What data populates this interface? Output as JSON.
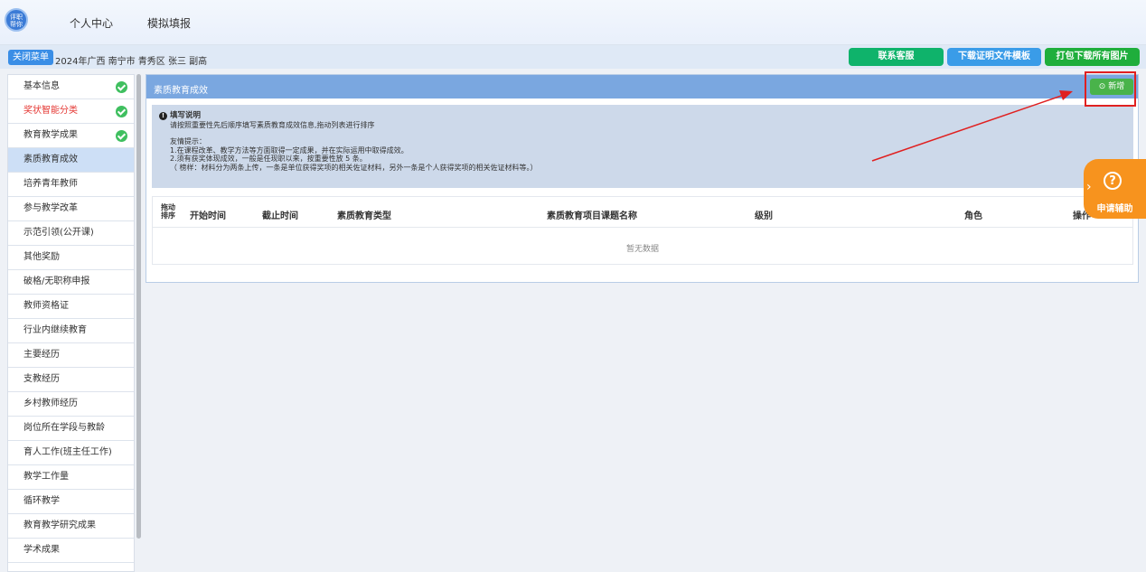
{
  "header": {
    "logo_text": "评职\n帮你",
    "nav": [
      "个人中心",
      "模拟填报"
    ]
  },
  "subbar": {
    "close_menu": "关闭菜单",
    "crumb": "2024年广西 南宁市 青秀区 张三 副高",
    "buttons": [
      "联系客服",
      "下载证明文件模板",
      "打包下载所有图片"
    ]
  },
  "sidebar": {
    "items": [
      {
        "label": "基本信息",
        "done": true
      },
      {
        "label": "奖状智能分类",
        "done": true,
        "red": true
      },
      {
        "label": "教育教学成果",
        "done": true
      },
      {
        "label": "素质教育成效",
        "active": true
      },
      {
        "label": "培养青年教师"
      },
      {
        "label": "参与教学改革"
      },
      {
        "label": "示范引领(公开课)"
      },
      {
        "label": "其他奖励"
      },
      {
        "label": "破格/无职称申报"
      },
      {
        "label": "教师资格证"
      },
      {
        "label": "行业内继续教育"
      },
      {
        "label": "主要经历"
      },
      {
        "label": "支教经历"
      },
      {
        "label": "乡村教师经历"
      },
      {
        "label": "岗位所在学段与教龄"
      },
      {
        "label": "育人工作(班主任工作)"
      },
      {
        "label": "教学工作量"
      },
      {
        "label": "循环教学"
      },
      {
        "label": "教育教学研究成果"
      },
      {
        "label": "学术成果"
      }
    ]
  },
  "panel": {
    "title": "素质教育成效",
    "add_label": "⊙ 新增",
    "notice": {
      "title": "填写说明",
      "line1": "请按照重要性先后顺序填写素质教育成效信息,拖动列表进行排序",
      "tip": "友情提示：",
      "l1": "1.在课程改革、教学方法等方面取得一定成果，并在实际运用中取得成效。",
      "l2": "2.须有获奖体现成效，一般是任现职以来，按重要性放 5 条。",
      "l3": "（ 榜样：材料分为两条上传，一条是单位获得奖项的相关佐证材料，另外一条是个人获得奖项的相关佐证材料等。）"
    },
    "table": {
      "sort_header": "拖动\n排序",
      "headers": [
        "开始时间",
        "截止时间",
        "素质教育类型",
        "素质教育项目课题名称",
        "级别",
        "角色",
        "操作"
      ],
      "empty_text": "暂无数据"
    }
  },
  "help": {
    "label": "申请辅助",
    "icon": "?"
  },
  "colors": {
    "accent": "#3a8ee6",
    "green": "#0fb36b",
    "panel_head": "#7aa7e0",
    "add": "#49b34a",
    "help": "#f7931e"
  }
}
